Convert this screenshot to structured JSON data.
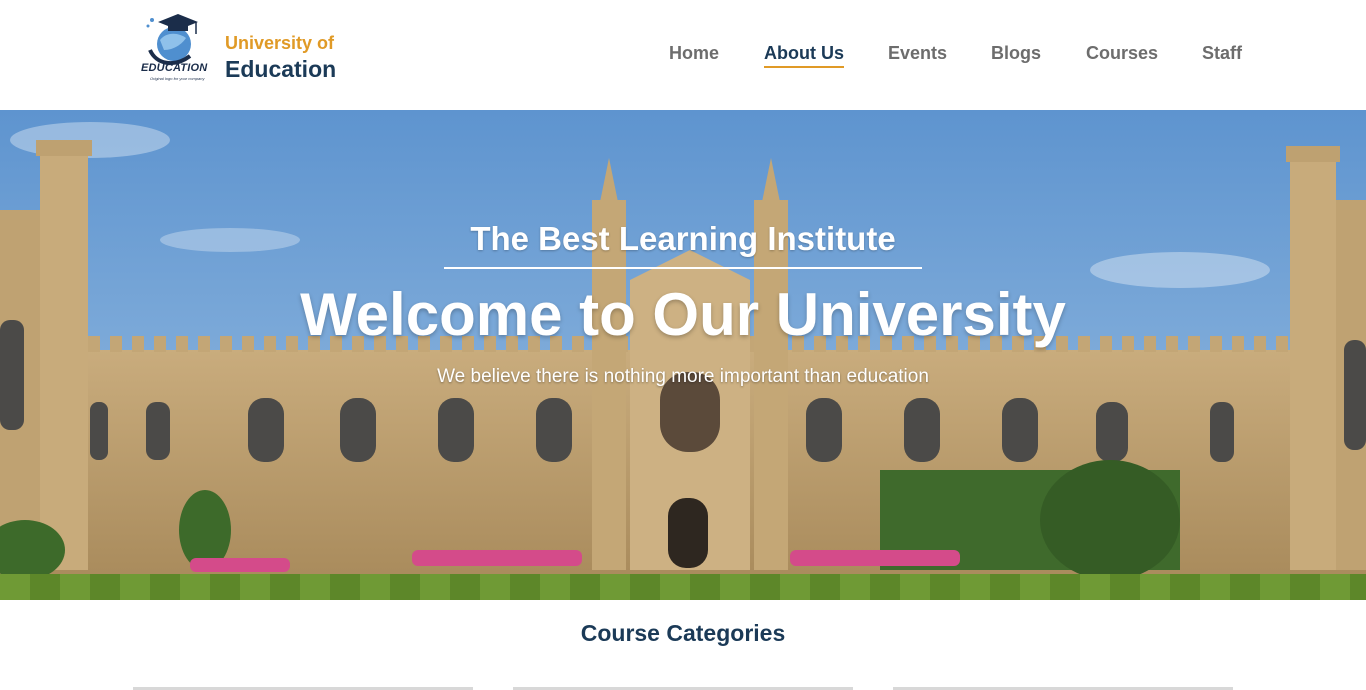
{
  "brand": {
    "logo_word": "EDUCATION",
    "logo_tagline": "Original logo for your company",
    "line1": "University of",
    "line2": "Education"
  },
  "nav": {
    "items": [
      {
        "label": "Home",
        "active": false
      },
      {
        "label": "About Us",
        "active": true
      },
      {
        "label": "Events",
        "active": false
      },
      {
        "label": "Blogs",
        "active": false
      },
      {
        "label": "Courses",
        "active": false
      },
      {
        "label": "Staff",
        "active": false
      }
    ]
  },
  "hero": {
    "kicker": "The Best Learning Institute",
    "title": "Welcome to Our University",
    "subtitle": "We believe there is nothing more important than education",
    "image": "university-courtyard-photo"
  },
  "categories": {
    "title": "Course Categories"
  },
  "colors": {
    "accent": "#e09a26",
    "brand_dark": "#1b3a57",
    "nav_text": "#6d6d6d"
  }
}
